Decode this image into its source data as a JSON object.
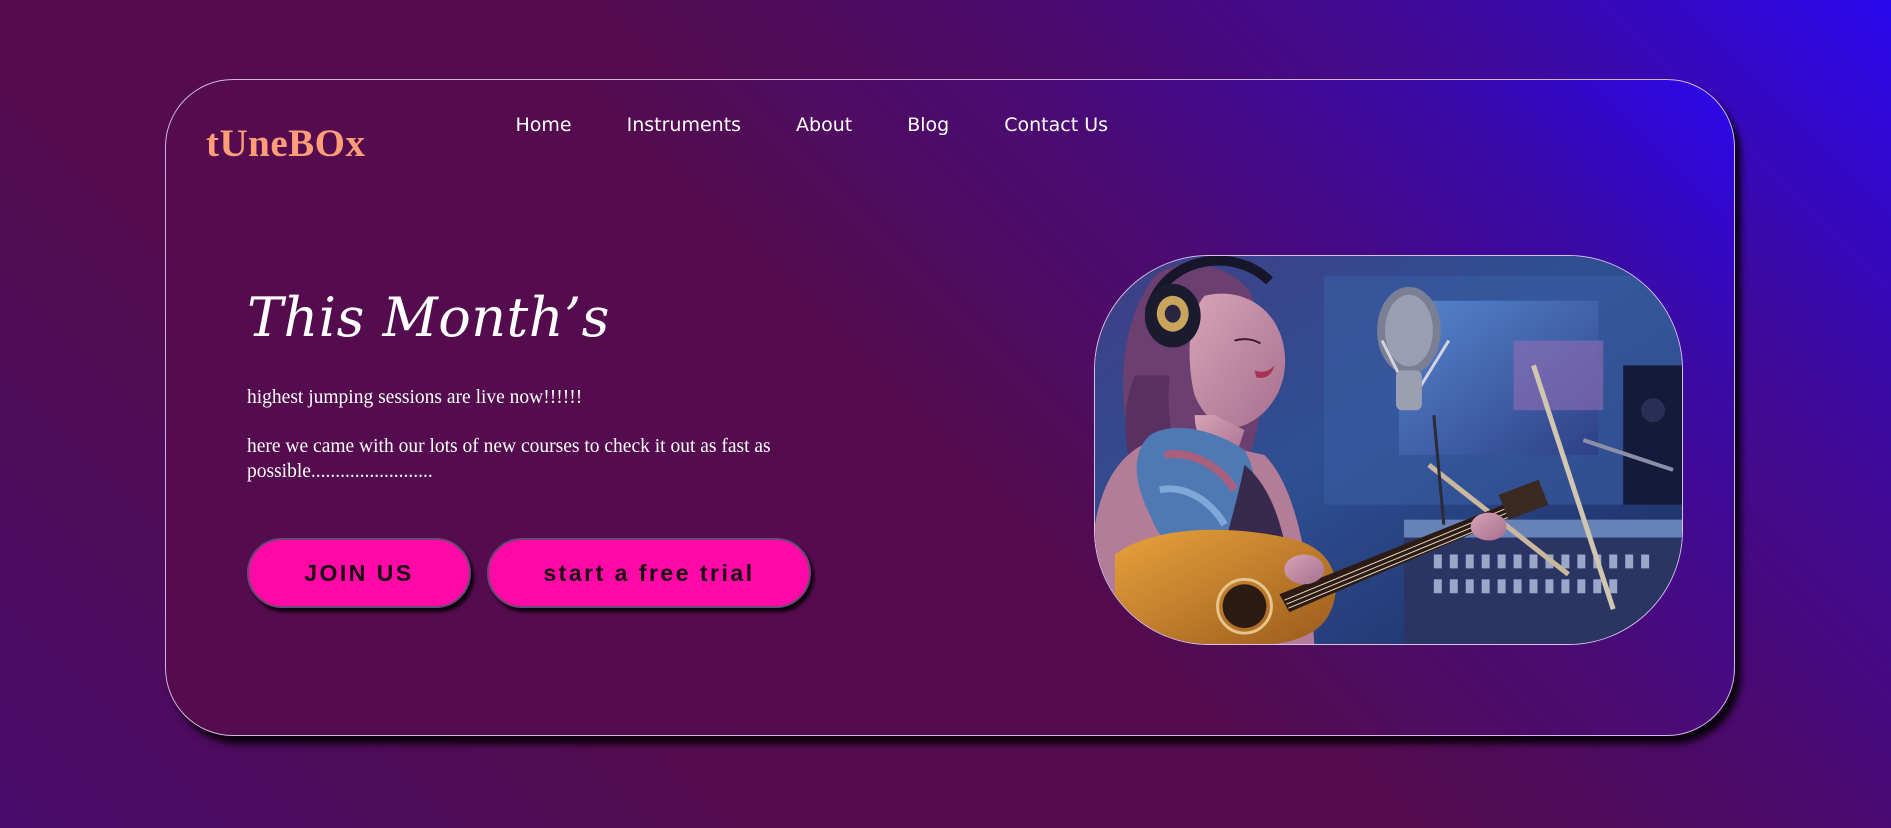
{
  "brand": {
    "logo_text": "tUneBOx"
  },
  "nav": {
    "items": [
      {
        "label": "Home"
      },
      {
        "label": "Instruments"
      },
      {
        "label": "About"
      },
      {
        "label": "Blog"
      },
      {
        "label": "Contact Us"
      }
    ]
  },
  "hero": {
    "headline": "This Month’s",
    "subtitle": "highest jumping sessions are live now!!!!!!",
    "description": "here we came with our lots of new courses to check it out as fast as possible.........................",
    "image_icon": "singer-with-guitar-photo"
  },
  "buttons": {
    "join_label": "JOIN US",
    "trial_label": "start a free trial"
  },
  "colors": {
    "logo": "#ff9d78",
    "button_bg": "#ff0aa6",
    "gradient_from": "#540c4e",
    "gradient_to": "#2a08ee"
  }
}
